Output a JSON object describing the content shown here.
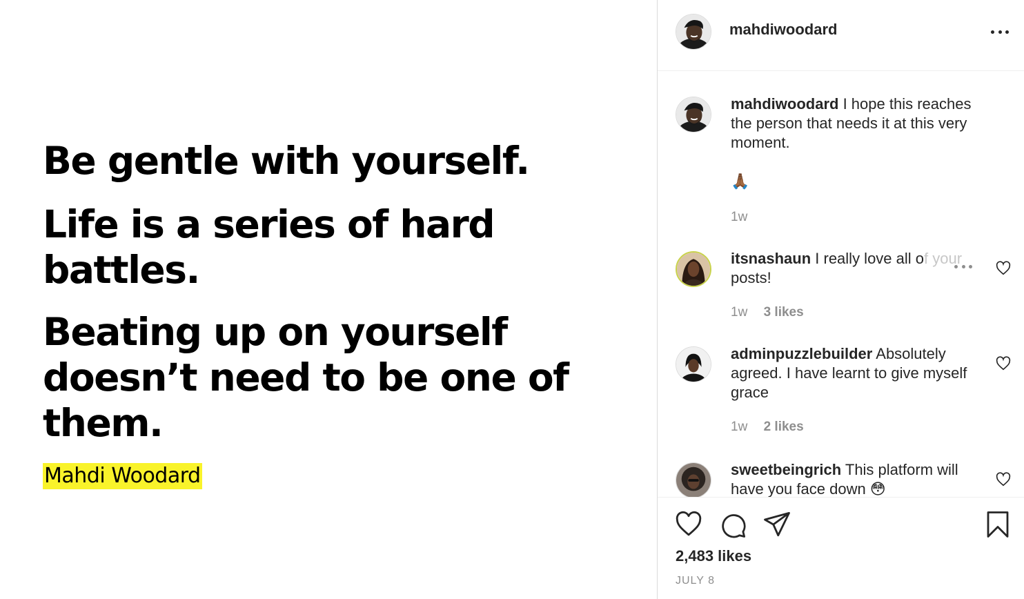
{
  "post": {
    "quote_lines": [
      "Be gentle with yourself.",
      "Life is a series of hard battles.",
      "Beating up on yourself doesn’t need to be one of them."
    ],
    "signature": "Mahdi Woodard"
  },
  "header": {
    "username": "mahdiwoodard"
  },
  "caption": {
    "username": "mahdiwoodard",
    "text": "I hope this reaches the person that needs it at this very moment.",
    "emoji": "🙏🏾",
    "time": "1w"
  },
  "comments": [
    {
      "username": "itsnashaun",
      "text_visible": "I really love all o",
      "text_faded": "f your",
      "text_rest": "posts!",
      "time": "1w",
      "likes": "3 likes"
    },
    {
      "username": "adminpuzzlebuilder",
      "text": "Absolutely agreed. I have learnt to give myself grace",
      "time": "1w",
      "likes": "2 likes"
    },
    {
      "username": "sweetbeingrich",
      "text": "This platform will have you face down 😳"
    }
  ],
  "actions": {
    "likes_count": "2,483 likes",
    "date": "JULY 8"
  },
  "icons": {
    "like": "heart-icon",
    "comment": "comment-icon",
    "share": "paper-plane-icon",
    "save": "bookmark-icon",
    "more": "more-horizontal-icon"
  },
  "colors": {
    "highlight": "#f9f32a",
    "text": "#262626",
    "muted": "#8e8e8e",
    "divider": "#dbdbdb"
  }
}
